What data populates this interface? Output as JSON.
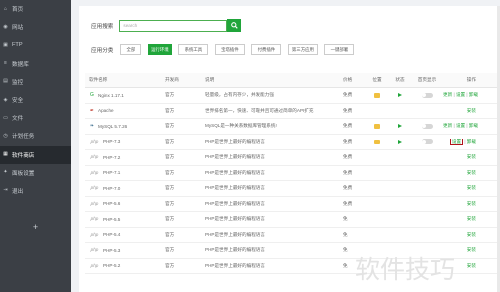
{
  "sidebar": {
    "items": [
      {
        "label": "首页",
        "icon": "home-icon",
        "glyph": "⌂",
        "active": false
      },
      {
        "label": "网站",
        "icon": "globe-icon",
        "glyph": "◉",
        "active": false
      },
      {
        "label": "FTP",
        "icon": "ftp-icon",
        "glyph": "▣",
        "active": false
      },
      {
        "label": "数据库",
        "icon": "database-icon",
        "glyph": "≡",
        "active": false
      },
      {
        "label": "监控",
        "icon": "monitor-icon",
        "glyph": "▤",
        "active": false
      },
      {
        "label": "安全",
        "icon": "shield-icon",
        "glyph": "◈",
        "active": false
      },
      {
        "label": "文件",
        "icon": "folder-icon",
        "glyph": "▭",
        "active": false
      },
      {
        "label": "计划任务",
        "icon": "clock-icon",
        "glyph": "◷",
        "active": false
      },
      {
        "label": "软件商店",
        "icon": "grid-icon",
        "glyph": "▦",
        "active": true
      },
      {
        "label": "面板设置",
        "icon": "gear-icon",
        "glyph": "✦",
        "active": false
      },
      {
        "label": "退出",
        "icon": "logout-icon",
        "glyph": "⇥",
        "active": false
      }
    ],
    "add": "+"
  },
  "search": {
    "label": "应用搜索",
    "placeholder": "search"
  },
  "categories": {
    "label": "应用分类",
    "items": [
      {
        "label": "全部",
        "active": false
      },
      {
        "label": "运行环境",
        "active": true
      },
      {
        "label": "系统工具",
        "active": false
      },
      {
        "label": "宝塔插件",
        "active": false
      },
      {
        "label": "付费插件",
        "active": false
      },
      {
        "label": "第三方应用",
        "active": false
      },
      {
        "label": "一键部署",
        "active": false
      }
    ]
  },
  "table": {
    "headers": {
      "name": "软件名称",
      "dev": "开发商",
      "desc": "说明",
      "price": "价格",
      "loc": "位置",
      "status": "状态",
      "home": "首页显示",
      "op": "操作"
    },
    "rows": [
      {
        "logo": "G",
        "logo_color": "#20a53a",
        "name": "Nginx 1.17.1",
        "dev": "官方",
        "desc": "轻量级，占有内存少，并发能力强",
        "price": "免费",
        "installed": true,
        "op": [
          "更新",
          "设置",
          "卸载"
        ],
        "highlight": false
      },
      {
        "logo": "✒",
        "logo_color": "#c0392b",
        "name": "Apache",
        "dev": "官方",
        "desc": "世界排名第一，快速、可靠并且可通过简单的API扩充",
        "price": "免费",
        "installed": false,
        "op": [
          "安装"
        ],
        "highlight": false
      },
      {
        "logo": "❧",
        "logo_color": "#3d6f8f",
        "name": "MySQL 5.7.26",
        "dev": "官方",
        "desc": "MySQL是一种关系数据库管理系统!",
        "price": "免费",
        "installed": true,
        "op": [
          "更新",
          "设置",
          "卸载"
        ],
        "highlight": false
      },
      {
        "logo": "php",
        "logo_color": "#999999",
        "name": "PHP-7.3",
        "dev": "官方",
        "desc": "PHP是世界上最好的编程语言",
        "price": "免费",
        "installed": true,
        "op": [
          "设置",
          "卸载"
        ],
        "highlight": true
      },
      {
        "logo": "php",
        "logo_color": "#999999",
        "name": "PHP-7.2",
        "dev": "官方",
        "desc": "PHP是世界上最好的编程语言",
        "price": "免费",
        "installed": false,
        "op": [
          "安装"
        ],
        "highlight": false
      },
      {
        "logo": "php",
        "logo_color": "#999999",
        "name": "PHP-7.1",
        "dev": "官方",
        "desc": "PHP是世界上最好的编程语言",
        "price": "免费",
        "installed": false,
        "op": [
          "安装"
        ],
        "highlight": false
      },
      {
        "logo": "php",
        "logo_color": "#999999",
        "name": "PHP-7.0",
        "dev": "官方",
        "desc": "PHP是世界上最好的编程语言",
        "price": "免费",
        "installed": false,
        "op": [
          "安装"
        ],
        "highlight": false
      },
      {
        "logo": "php",
        "logo_color": "#999999",
        "name": "PHP-5.6",
        "dev": "官方",
        "desc": "PHP是世界上最好的编程语言",
        "price": "免费",
        "installed": false,
        "op": [
          "安装"
        ],
        "highlight": false
      },
      {
        "logo": "php",
        "logo_color": "#999999",
        "name": "PHP-5.5",
        "dev": "官方",
        "desc": "PHP是世界上最好的编程语言",
        "price": "免",
        "installed": false,
        "op": [
          "安装"
        ],
        "highlight": false
      },
      {
        "logo": "php",
        "logo_color": "#999999",
        "name": "PHP-5.4",
        "dev": "官方",
        "desc": "PHP是世界上最好的编程语言",
        "price": "免",
        "installed": false,
        "op": [
          "安装"
        ],
        "highlight": false
      },
      {
        "logo": "php",
        "logo_color": "#999999",
        "name": "PHP-5.3",
        "dev": "官方",
        "desc": "PHP是世界上最好的编程语言",
        "price": "免",
        "installed": false,
        "op": [
          "安装"
        ],
        "highlight": false
      },
      {
        "logo": "php",
        "logo_color": "#999999",
        "name": "PHP-5.2",
        "dev": "官方",
        "desc": "PHP是世界上最好的编程语言",
        "price": "免",
        "installed": false,
        "op": [
          "安装"
        ],
        "highlight": false
      }
    ]
  },
  "watermark": "软件技巧",
  "colors": {
    "accent": "#20a53a",
    "sidebar_bg": "#3b3f45",
    "highlight": "#b3131b"
  }
}
